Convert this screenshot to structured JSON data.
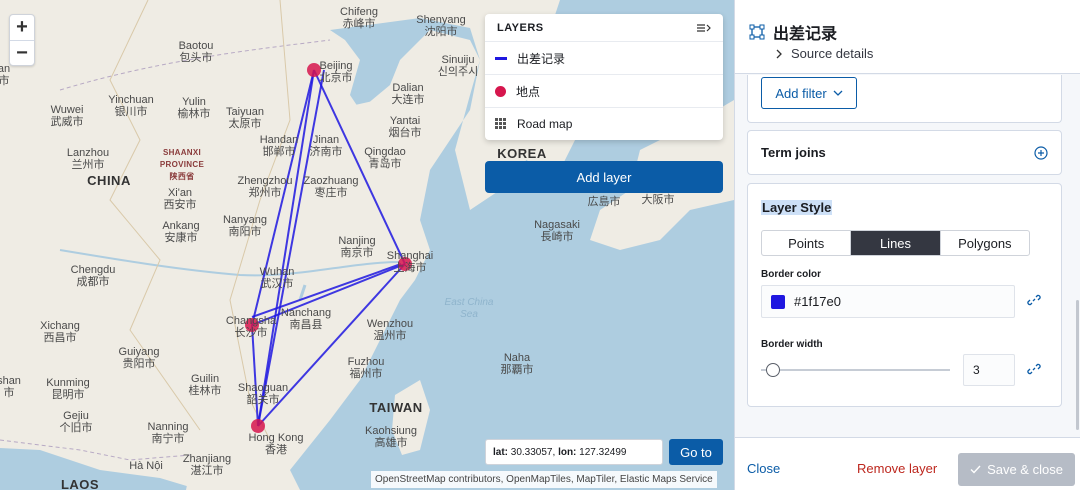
{
  "map": {
    "zoom_in": "+",
    "zoom_out": "−",
    "places": [
      {
        "id": "chifeng",
        "lines": [
          "Chifeng",
          "赤峰市"
        ]
      },
      {
        "id": "shenyang",
        "lines": [
          "Shenyang",
          "沈阳市"
        ]
      },
      {
        "id": "sinuiju",
        "lines": [
          "Sinuiju",
          "신의주시"
        ]
      },
      {
        "id": "baotou",
        "lines": [
          "Baotou",
          "包头市"
        ]
      },
      {
        "id": "beijing",
        "lines": [
          "Beijing",
          "北京市"
        ]
      },
      {
        "id": "dalian",
        "lines": [
          "Dalian",
          "大连市"
        ]
      },
      {
        "id": "yinchuan",
        "lines": [
          "Yinchuan",
          "银川市"
        ]
      },
      {
        "id": "yulin",
        "lines": [
          "Yulin",
          "榆林市"
        ]
      },
      {
        "id": "wuwei",
        "lines": [
          "Wuwei",
          "武威市"
        ]
      },
      {
        "id": "taiyuan",
        "lines": [
          "Taiyuan",
          "太原市"
        ]
      },
      {
        "id": "yantai",
        "lines": [
          "Yantai",
          "烟台市"
        ]
      },
      {
        "id": "handan",
        "lines": [
          "Handan",
          "邯郸市"
        ]
      },
      {
        "id": "jinan",
        "lines": [
          "Jinan",
          "济南市"
        ]
      },
      {
        "id": "qingdao",
        "lines": [
          "Qingdao",
          "青岛市"
        ]
      },
      {
        "id": "lanzhou",
        "lines": [
          "Lanzhou",
          "兰州市"
        ]
      },
      {
        "id": "zhengzhou",
        "lines": [
          "Zhengzhou",
          "郑州市"
        ]
      },
      {
        "id": "zaozhuang",
        "lines": [
          "Zaozhuang",
          "枣庄市"
        ]
      },
      {
        "id": "xian",
        "lines": [
          "Xi'an",
          "西安市"
        ]
      },
      {
        "id": "nanyang",
        "lines": [
          "Nanyang",
          "南阳市"
        ]
      },
      {
        "id": "ankang",
        "lines": [
          "Ankang",
          "安康市"
        ]
      },
      {
        "id": "nanjing",
        "lines": [
          "Nanjing",
          "南京市"
        ]
      },
      {
        "id": "shanghai",
        "lines": [
          "Shanghai",
          "上海市"
        ]
      },
      {
        "id": "chengdu",
        "lines": [
          "Chengdu",
          "成都市"
        ]
      },
      {
        "id": "wuhan",
        "lines": [
          "Wuhan",
          "武汉市"
        ]
      },
      {
        "id": "nagasaki",
        "lines": [
          "Nagasaki",
          "長崎市"
        ]
      },
      {
        "id": "changsha",
        "lines": [
          "Changsha",
          "长沙市"
        ]
      },
      {
        "id": "nanchang",
        "lines": [
          "Nanchang",
          "南昌县"
        ]
      },
      {
        "id": "xichang",
        "lines": [
          "Xichang",
          "西昌市"
        ]
      },
      {
        "id": "wenzhou",
        "lines": [
          "Wenzhou",
          "温州市"
        ]
      },
      {
        "id": "guiyang",
        "lines": [
          "Guiyang",
          "贵阳市"
        ]
      },
      {
        "id": "fuzhou",
        "lines": [
          "Fuzhou",
          "福州市"
        ]
      },
      {
        "id": "naha",
        "lines": [
          "Naha",
          "那覇市"
        ]
      },
      {
        "id": "kunming",
        "lines": [
          "Kunming",
          "昆明市"
        ]
      },
      {
        "id": "guilin",
        "lines": [
          "Guilin",
          "桂林市"
        ]
      },
      {
        "id": "shaoguan",
        "lines": [
          "Shaoguan",
          "韶关市"
        ]
      },
      {
        "id": "gejiu",
        "lines": [
          "Gejiu",
          "个旧市"
        ]
      },
      {
        "id": "kaohsiung",
        "lines": [
          "Kaohsiung",
          "高雄市"
        ]
      },
      {
        "id": "nanning",
        "lines": [
          "Nanning",
          "南宁市"
        ]
      },
      {
        "id": "hongkong",
        "lines": [
          "Hong Kong",
          "香港"
        ]
      },
      {
        "id": "zhanjiang",
        "lines": [
          "Zhanjiang",
          "湛江市"
        ]
      },
      {
        "id": "hanoi",
        "lines": [
          "Hà Nội"
        ]
      },
      {
        "id": "guangshi",
        "lines": [
          "広島市"
        ]
      },
      {
        "id": "daban",
        "lines": [
          "大阪市"
        ]
      },
      {
        "id": "unnamed_nw",
        "lines": [
          "an",
          "市"
        ]
      },
      {
        "id": "unnamed_sw",
        "lines": [
          "shan",
          "市"
        ]
      }
    ],
    "regions": [
      {
        "id": "china",
        "text": "CHINA"
      },
      {
        "id": "taiwan",
        "text": "TAIWAN"
      },
      {
        "id": "korea",
        "text": "KOREA"
      },
      {
        "id": "laos",
        "text": "LAOS"
      },
      {
        "id": "shaanxi",
        "lines": [
          "SHAANXI",
          "PROVINCE",
          "陕西省"
        ]
      },
      {
        "id": "sea",
        "lines": [
          "East China",
          "Sea"
        ]
      }
    ],
    "layers": {
      "title": "LAYERS",
      "items": [
        {
          "label": "出差记录",
          "swatch": "line",
          "color": "#1f17e0"
        },
        {
          "label": "地点",
          "swatch": "dot",
          "color": "#d6164d"
        },
        {
          "label": "Road map",
          "swatch": "grid"
        }
      ],
      "add_label": "Add layer"
    },
    "coord": {
      "lat_label": "lat:",
      "lat": "30.33057,",
      "lon_label": "lon:",
      "lon": "127.32499"
    },
    "goto_label": "Go to",
    "attribution": "OpenStreetMap contributors, OpenMapTiles, MapTiler, Elastic Maps Service"
  },
  "panel": {
    "title": "出差记录",
    "source_details": "Source details",
    "add_filter": "Add filter",
    "term_joins": "Term joins",
    "layer_style": "Layer Style",
    "style_tabs": [
      {
        "label": "Points",
        "active": false
      },
      {
        "label": "Lines",
        "active": true
      },
      {
        "label": "Polygons",
        "active": false
      }
    ],
    "border_color_label": "Border color",
    "border_color_value": "#1f17e0",
    "border_width_label": "Border width",
    "border_width_value": "3",
    "border_width_fraction": 0.03,
    "footer": {
      "close": "Close",
      "remove": "Remove layer",
      "save": "Save & close"
    }
  },
  "colors": {
    "accent": "#0b5ca7",
    "line": "#1f17e0",
    "point": "#d6164d",
    "danger": "#bd271e"
  }
}
